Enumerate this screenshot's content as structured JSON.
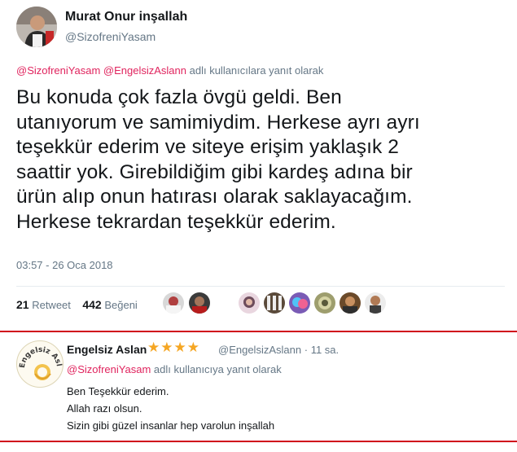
{
  "tweet": {
    "display_name": "Murat Onur inşallah",
    "handle": "@SizofreniYasam",
    "reply_mention_1": "@SizofreniYasam",
    "reply_mention_2": "@EngelsizAslann",
    "reply_suffix": "adlı kullanıcılara yanıt olarak",
    "body_lines": [
      "Bu konuda çok fazla övgü geldi. Ben",
      "utanıyorum ve samimiydim. Herkese ayrı ayrı",
      "teşekkür ederim ve siteye erişim yaklaşık 2",
      "saattir yok. Girebildiğim gibi kardeş adına bir",
      "ürün alıp onun hatırası olarak saklayacağım.",
      "Herkese tekrardan teşekkür ederim."
    ],
    "timestamp": "03:57 - 26 Oca 2018",
    "retweet_count": "21",
    "retweet_label": "Retweet",
    "like_count": "442",
    "like_label": "Beğeni"
  },
  "reply": {
    "display_name": "Engelsiz Aslan",
    "stars": "★★★★",
    "handle": "@EngelsizAslann",
    "separator": "·",
    "time": "11 sa.",
    "reply_mention": "@SizofreniYasam",
    "reply_suffix": "adlı kullanıcıya yanıt olarak",
    "avatar_text": "Engelsiz Aslan",
    "body_lines": [
      "Ben Teşekkür ederim.",
      "Allah razı olsun.",
      "Sizin gibi güzel insanlar hep varolun inşallah"
    ]
  },
  "colors": {
    "accent_mention": "#e0245e",
    "separator_red": "#d0021b",
    "star": "#f5a623",
    "muted": "#657786"
  }
}
